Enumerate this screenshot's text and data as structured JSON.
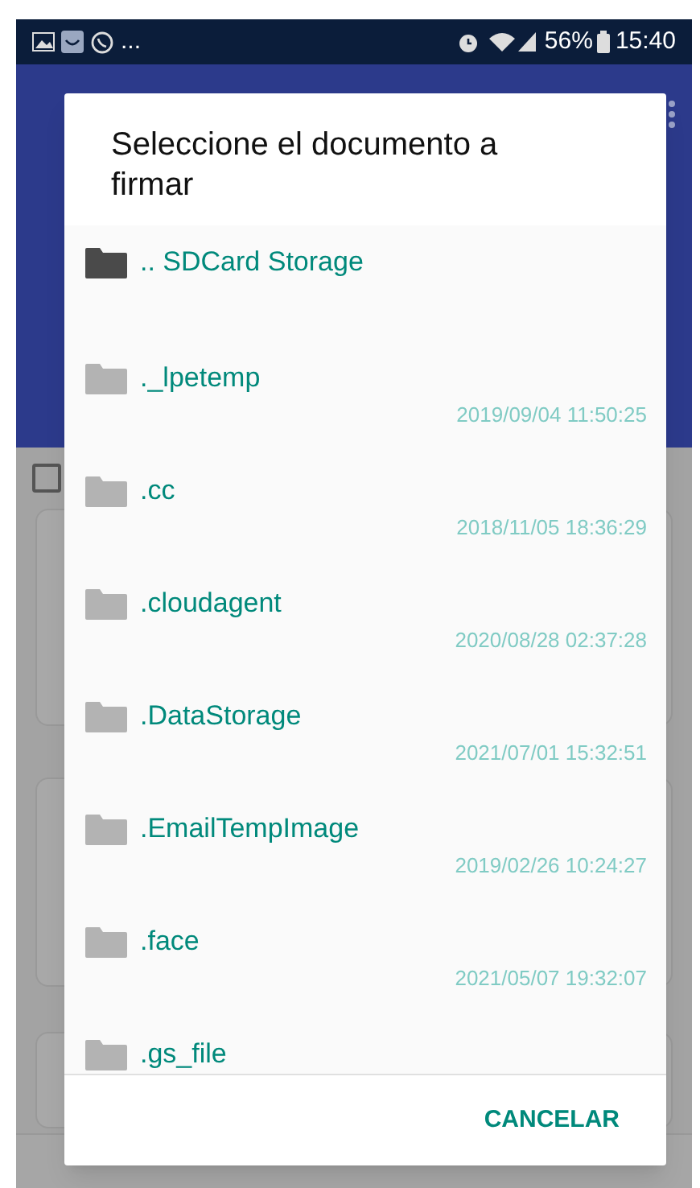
{
  "status_bar": {
    "notification_more": "...",
    "battery": "56%",
    "time": "15:40"
  },
  "dialog": {
    "title": "Seleccione el documento a firmar",
    "items": [
      {
        "kind": "parent",
        "name": ".. SDCard Storage"
      },
      {
        "kind": "folder",
        "name": "._lpetemp",
        "date": "2019/09/04 11:50:25"
      },
      {
        "kind": "folder",
        "name": ".cc",
        "date": "2018/11/05 18:36:29"
      },
      {
        "kind": "folder",
        "name": ".cloudagent",
        "date": "2020/08/28 02:37:28"
      },
      {
        "kind": "folder",
        "name": ".DataStorage",
        "date": "2021/07/01 15:32:51"
      },
      {
        "kind": "folder",
        "name": ".EmailTempImage",
        "date": "2019/02/26 10:24:27"
      },
      {
        "kind": "folder",
        "name": ".face",
        "date": "2021/05/07 19:32:07"
      },
      {
        "kind": "folder",
        "name": ".gs_file"
      }
    ],
    "cancel_button": "CANCELAR"
  },
  "select_all": {
    "checked": false
  }
}
